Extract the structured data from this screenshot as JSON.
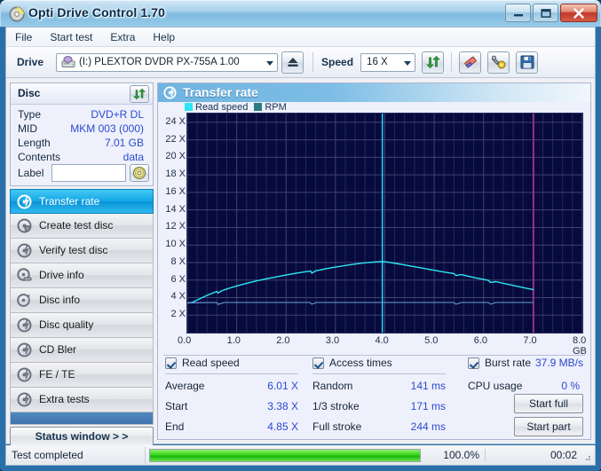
{
  "window": {
    "title": "Opti Drive Control 1.70",
    "icon": "disc-icon",
    "buttons": {
      "minimize": "minimize-icon",
      "maximize": "maximize-icon",
      "close": "close-icon"
    }
  },
  "menu": {
    "items": [
      "File",
      "Start test",
      "Extra",
      "Help"
    ]
  },
  "toolbar": {
    "drive_label": "Drive",
    "drive_value": "(I:)  PLEXTOR DVDR   PX-755A 1.00",
    "eject_icon": "eject-icon",
    "speed_label": "Speed",
    "speed_value": "16 X",
    "refresh_icon": "refresh-icon",
    "eraser_icon": "eraser-icon",
    "tools_icon": "tools-icon",
    "save_icon": "save-icon"
  },
  "disc": {
    "header": "Disc",
    "refresh_icon": "refresh-icon",
    "rows": [
      {
        "key": "Type",
        "value": "DVD+R DL"
      },
      {
        "key": "MID",
        "value": "MKM 003 (000)"
      },
      {
        "key": "Length",
        "value": "7.01 GB"
      },
      {
        "key": "Contents",
        "value": "data"
      }
    ],
    "label_key": "Label",
    "label_value": "",
    "label_placeholder": "",
    "label_button_icon": "disc-icon"
  },
  "nav": {
    "items": [
      {
        "label": "Transfer rate",
        "icon": "disc-test-icon",
        "active": true
      },
      {
        "label": "Create test disc",
        "icon": "disc-test-icon",
        "active": false
      },
      {
        "label": "Verify test disc",
        "icon": "disc-test-icon",
        "active": false
      },
      {
        "label": "Drive info",
        "icon": "disc-test-icon",
        "active": false
      },
      {
        "label": "Disc info",
        "icon": "disc-test-icon",
        "active": false
      },
      {
        "label": "Disc quality",
        "icon": "disc-test-icon",
        "active": false
      },
      {
        "label": "CD Bler",
        "icon": "disc-test-icon",
        "active": false
      },
      {
        "label": "FE / TE",
        "icon": "disc-test-icon",
        "active": false
      },
      {
        "label": "Extra tests",
        "icon": "disc-test-icon",
        "active": false
      }
    ],
    "status_window_button": "Status window > >"
  },
  "panel": {
    "title": "Transfer rate",
    "icon": "disc-test-icon"
  },
  "chart_data": {
    "type": "line",
    "title": "Transfer rate",
    "xlabel": "GB",
    "ylabel": "X",
    "xlim": [
      0.0,
      8.0
    ],
    "ylim": [
      0.0,
      25.0
    ],
    "grid": true,
    "legend_position": "top-left",
    "x_ticks": [
      "0.0",
      "1.0",
      "2.0",
      "3.0",
      "4.0",
      "5.0",
      "6.0",
      "7.0",
      "8.0"
    ],
    "x_unit": "GB",
    "y_ticks": [
      "24 X",
      "22 X",
      "20 X",
      "18 X",
      "16 X",
      "14 X",
      "12 X",
      "10 X",
      "8 X",
      "6 X",
      "4 X",
      "2 X"
    ],
    "plot_bg": "#070a3c",
    "markers": [
      {
        "name": "average-marker",
        "x": 3.95,
        "color": "#2ad0f0"
      },
      {
        "name": "disc-end-marker",
        "x": 7.01,
        "color": "#b0309a"
      }
    ],
    "series": [
      {
        "name": "Read speed",
        "color": "#2ce6f5",
        "points": [
          [
            0.0,
            3.38
          ],
          [
            0.1,
            3.45
          ],
          [
            0.2,
            3.72
          ],
          [
            0.3,
            4.0
          ],
          [
            0.4,
            4.25
          ],
          [
            0.5,
            4.48
          ],
          [
            0.6,
            4.7
          ],
          [
            0.62,
            4.52
          ],
          [
            0.7,
            4.78
          ],
          [
            0.8,
            4.98
          ],
          [
            0.9,
            5.16
          ],
          [
            1.0,
            5.32
          ],
          [
            1.2,
            5.62
          ],
          [
            1.4,
            5.9
          ],
          [
            1.6,
            6.14
          ],
          [
            1.8,
            6.36
          ],
          [
            2.0,
            6.57
          ],
          [
            2.2,
            6.77
          ],
          [
            2.4,
            6.95
          ],
          [
            2.5,
            7.03
          ],
          [
            2.52,
            6.78
          ],
          [
            2.6,
            7.05
          ],
          [
            2.8,
            7.28
          ],
          [
            3.0,
            7.48
          ],
          [
            3.2,
            7.66
          ],
          [
            3.4,
            7.82
          ],
          [
            3.6,
            7.96
          ],
          [
            3.8,
            8.06
          ],
          [
            3.95,
            8.12
          ],
          [
            4.05,
            8.05
          ],
          [
            4.2,
            7.92
          ],
          [
            4.4,
            7.72
          ],
          [
            4.6,
            7.52
          ],
          [
            4.8,
            7.32
          ],
          [
            5.0,
            7.12
          ],
          [
            5.2,
            6.92
          ],
          [
            5.4,
            6.74
          ],
          [
            5.44,
            6.52
          ],
          [
            5.55,
            6.62
          ],
          [
            5.7,
            6.42
          ],
          [
            5.9,
            6.18
          ],
          [
            6.1,
            5.96
          ],
          [
            6.14,
            5.72
          ],
          [
            6.25,
            5.82
          ],
          [
            6.4,
            5.62
          ],
          [
            6.6,
            5.38
          ],
          [
            6.8,
            5.14
          ],
          [
            7.0,
            4.92
          ],
          [
            7.01,
            4.85
          ]
        ]
      },
      {
        "name": "RPM",
        "color": "#6d9fd8",
        "points": [
          [
            0.0,
            3.38
          ],
          [
            0.3,
            3.42
          ],
          [
            0.6,
            3.44
          ],
          [
            0.62,
            3.22
          ],
          [
            0.75,
            3.44
          ],
          [
            1.5,
            3.44
          ],
          [
            2.48,
            3.44
          ],
          [
            2.52,
            3.24
          ],
          [
            2.62,
            3.44
          ],
          [
            4.0,
            3.44
          ],
          [
            5.4,
            3.44
          ],
          [
            5.44,
            3.24
          ],
          [
            5.55,
            3.44
          ],
          [
            6.1,
            3.44
          ],
          [
            6.14,
            3.24
          ],
          [
            6.25,
            3.44
          ],
          [
            7.01,
            3.44
          ]
        ]
      }
    ]
  },
  "legend": [
    {
      "label": "Read speed",
      "color": "#2ce6f5"
    },
    {
      "label": "RPM",
      "color": "#2a7a82"
    }
  ],
  "results": {
    "read_speed": {
      "checkbox_label": "Read speed",
      "checked": true,
      "rows": [
        {
          "key": "Average",
          "value": "6.01 X"
        },
        {
          "key": "Start",
          "value": "3.38 X"
        },
        {
          "key": "End",
          "value": "4.85 X"
        }
      ]
    },
    "access_times": {
      "checkbox_label": "Access times",
      "checked": true,
      "rows": [
        {
          "key": "Random",
          "value": "141 ms"
        },
        {
          "key": "1/3 stroke",
          "value": "171 ms"
        },
        {
          "key": "Full stroke",
          "value": "244 ms"
        }
      ]
    },
    "burst": {
      "checkbox_label": "Burst rate",
      "checked": true,
      "value": "37.9 MB/s",
      "cpu_key": "CPU usage",
      "cpu_value": "0 %",
      "start_full_button": "Start full",
      "start_part_button": "Start part"
    }
  },
  "statusbar": {
    "text": "Test completed",
    "progress_percent": 100.0,
    "progress_label": "100.0%",
    "elapsed": "00:02"
  }
}
